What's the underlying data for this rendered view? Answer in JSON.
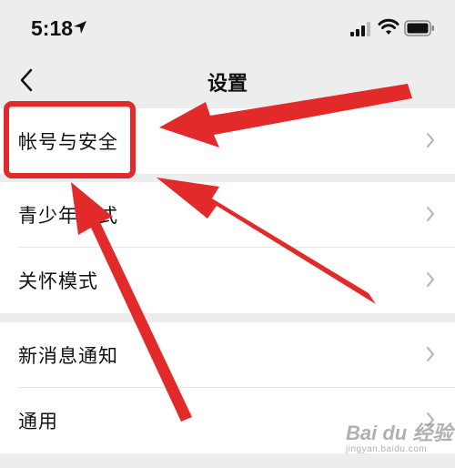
{
  "status_bar": {
    "time": "5:18",
    "icons": [
      "location-arrow-icon",
      "signal-icon",
      "wifi-icon",
      "battery-icon"
    ]
  },
  "nav": {
    "back_icon": "chevron-left-icon",
    "title": "设置"
  },
  "settings": {
    "groups": [
      {
        "items": [
          {
            "label": "帐号与安全"
          }
        ]
      },
      {
        "items": [
          {
            "label": "青少年模式"
          },
          {
            "label": "关怀模式"
          }
        ]
      },
      {
        "items": [
          {
            "label": "新消息通知"
          },
          {
            "label": "通用"
          }
        ]
      }
    ]
  },
  "annotation": {
    "color": "#e32a2a",
    "highlight_target": "帐号与安全"
  },
  "watermark": {
    "logo": "Bai du 经验",
    "sub": "jingyan.baidu.com"
  }
}
